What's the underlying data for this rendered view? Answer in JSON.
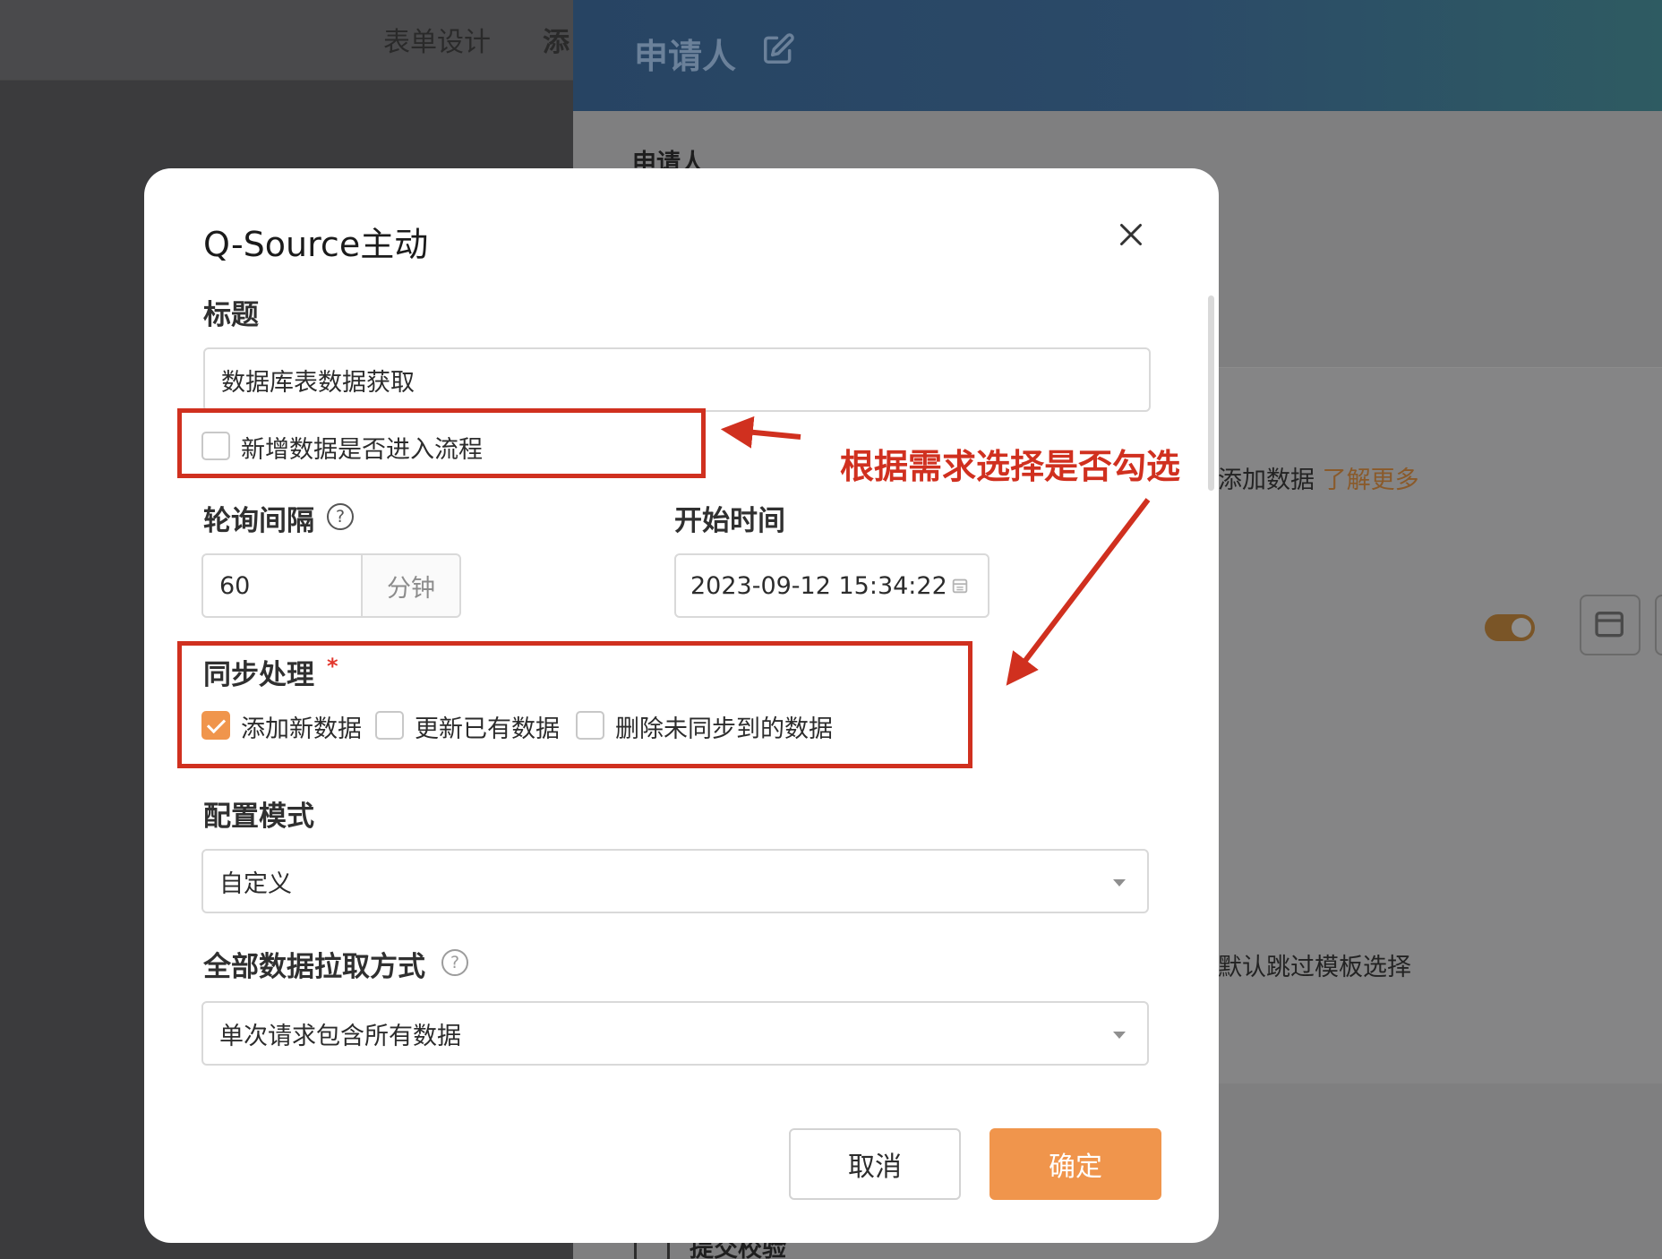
{
  "background": {
    "tabs": [
      "表单设计",
      "添"
    ],
    "panel_title": "申请人",
    "panel_field_label": "申请人",
    "panel_text_add": "添加数据",
    "panel_link": "了解更多",
    "panel_text_skip": "默认跳过模板选择",
    "bottom_label": "提交校验"
  },
  "dialog": {
    "title": "Q-Source主动",
    "title_label": "标题",
    "title_value": "数据库表数据获取",
    "enter_flow_label": "新增数据是否进入流程",
    "enter_flow_checked": false,
    "poll_label": "轮询间隔",
    "poll_value": "60",
    "poll_unit": "分钟",
    "start_label": "开始时间",
    "start_value": "2023-09-12 15:34:22",
    "sync_label": "同步处理",
    "required_mark": "*",
    "sync_options": [
      {
        "label": "添加新数据",
        "checked": true
      },
      {
        "label": "更新已有数据",
        "checked": false
      },
      {
        "label": "删除未同步到的数据",
        "checked": false
      }
    ],
    "mode_label": "配置模式",
    "mode_value": "自定义",
    "fetch_label": "全部数据拉取方式",
    "fetch_value": "单次请求包含所有数据",
    "cancel_label": "取消",
    "ok_label": "确定",
    "help_glyph": "?"
  },
  "annotation": {
    "text": "根据需求选择是否勾选",
    "color": "#d0301f"
  },
  "colors": {
    "accent": "#f0954c",
    "annotation_red": "#d0301f"
  }
}
